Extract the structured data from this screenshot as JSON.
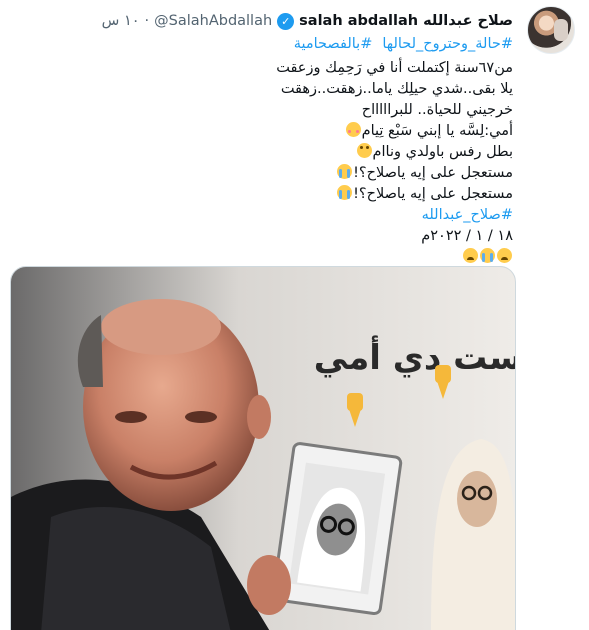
{
  "tweet": {
    "author_name": "صلاح عبدالله salah abdallah",
    "handle": "@SalahAbdallah",
    "separator": "·",
    "time": "١٠ س",
    "hashtags": [
      "#بالفصحامية",
      "#حالة_وحتروح_لحالها"
    ],
    "lines": [
      "من٦٧سنة إكتملت أنا في رَحِمِك وزعقت",
      "يلا بقى..شدي حيلِك ياما..زهقت..زهقت",
      "خرجيني للحياة.. للبراااااح",
      "أمي:لِسَّه يا إبني سَبْع تِيام",
      "بطل رفس باولدي وناام",
      "مستعجل على إيه ياصلاح؟!",
      "مستعجل على إيه ياصلاح؟!"
    ],
    "closing_tag": "#صلاح_عبدالله",
    "date": "١٨ / ١ / ٢٠٢٢م"
  },
  "media": {
    "overlay_text": "الست دي أمي"
  },
  "colors": {
    "link": "#1d9bf0",
    "secondary_text": "#536471",
    "verified": "#1d9bf0",
    "border": "#cfd9de"
  },
  "icons": [
    "verified-badge-icon",
    "flushed-face-icon",
    "rolling-eyes-icon",
    "sob-icon",
    "tired-face-icon",
    "pointing-down-icon"
  ]
}
